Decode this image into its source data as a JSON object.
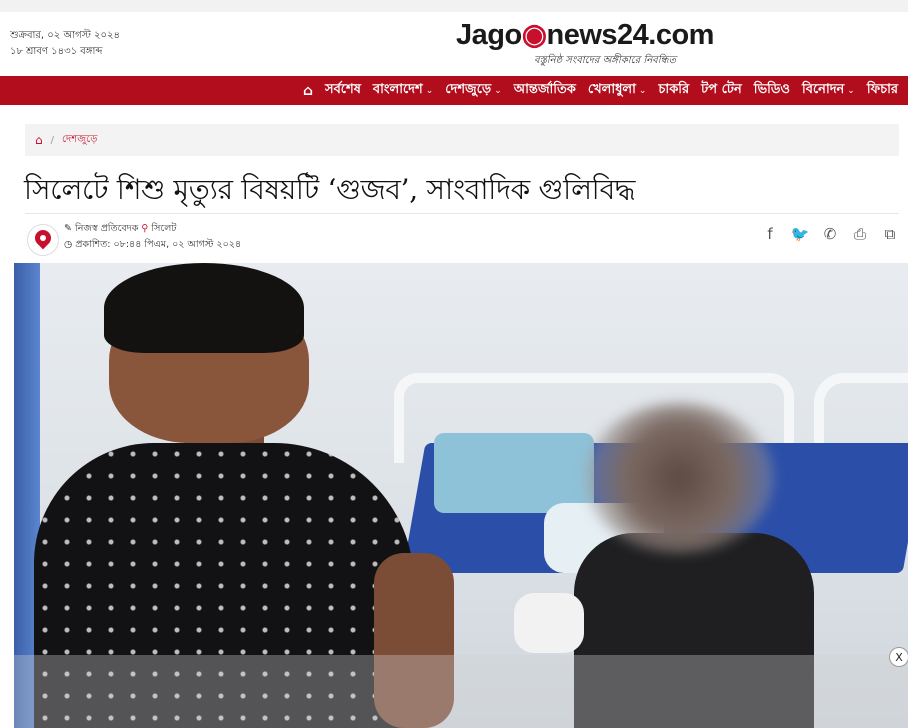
{
  "header": {
    "date_line_1": "শুক্রবার, ০২ আগস্ট ২০২৪",
    "date_line_2": "১৮ শ্রাবণ ১৪৩১ বঙ্গাব্দ",
    "logo_left": "Jago",
    "logo_right": "news24.com",
    "logo_tagline": "বস্তুনিষ্ঠ সংবাদের অঙ্গীকারে নিবন্ধিত"
  },
  "nav": {
    "home_icon": "home-icon",
    "items": [
      {
        "label": "সর্বশেষ",
        "dropdown": false
      },
      {
        "label": "বাংলাদেশ",
        "dropdown": true
      },
      {
        "label": "দেশজুড়ে",
        "dropdown": true
      },
      {
        "label": "আন্তর্জাতিক",
        "dropdown": false
      },
      {
        "label": "খেলাধুলা",
        "dropdown": true
      },
      {
        "label": "চাকরি",
        "dropdown": false
      },
      {
        "label": "টপ টেন",
        "dropdown": false
      },
      {
        "label": "ভিডিও",
        "dropdown": false
      },
      {
        "label": "বিনোদন",
        "dropdown": true
      },
      {
        "label": "ফিচার",
        "dropdown": false
      }
    ]
  },
  "breadcrumb": {
    "home_icon": "home-icon",
    "category": "দেশজুড়ে"
  },
  "article": {
    "headline": "সিলেটে শিশু মৃত্যুর বিষয়টি ‘গুজব’, সাংবাদিক গুলিবিদ্ধ",
    "author": "নিজস্ব প্রতিবেদক",
    "location": "সিলেট",
    "published": "প্রকাশিত: ০৮:৪৪ পিএম, ০২ আগস্ট ২০২৪"
  },
  "share": {
    "icons": [
      "facebook-icon",
      "twitter-icon",
      "whatsapp-icon",
      "print-icon",
      "copy-icon"
    ],
    "glyphs": [
      "f",
      "🐦",
      "✆",
      "⎙",
      "⧉"
    ]
  },
  "ad": {
    "close_label": "X"
  },
  "colors": {
    "brand_red": "#b10d1d",
    "accent_red": "#c8102e"
  }
}
